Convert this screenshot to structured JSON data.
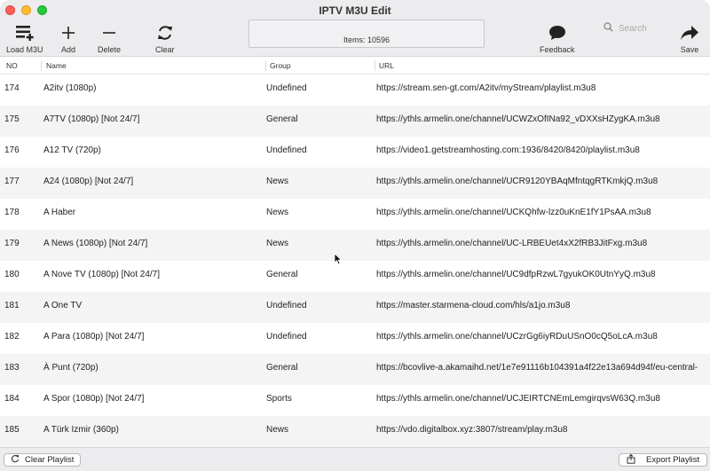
{
  "window": {
    "title": "IPTV M3U Edit"
  },
  "toolbar": {
    "load_label": "Load M3U",
    "add_label": "Add",
    "delete_label": "Delete",
    "clear_label": "Clear",
    "items_text": "Items: 10596",
    "feedback_label": "Feedback",
    "search_placeholder": "Search",
    "save_label": "Save"
  },
  "table": {
    "headers": {
      "no": "NO",
      "name": "Name",
      "group": "Group",
      "url": "URL"
    },
    "rows": [
      {
        "no": "174",
        "name": "A2itv (1080p)",
        "group": "Undefined",
        "url": "https://stream.sen-gt.com/A2itv/myStream/playlist.m3u8"
      },
      {
        "no": "175",
        "name": "A7TV (1080p) [Not 24/7]",
        "group": "General",
        "url": "https://ythls.armelin.one/channel/UCWZxOfINa92_vDXXsHZygKA.m3u8"
      },
      {
        "no": "176",
        "name": "A12 TV (720p)",
        "group": "Undefined",
        "url": "https://video1.getstreamhosting.com:1936/8420/8420/playlist.m3u8"
      },
      {
        "no": "177",
        "name": "A24 (1080p) [Not 24/7]",
        "group": "News",
        "url": "https://ythls.armelin.one/channel/UCR9120YBAqMfntqgRTKmkjQ.m3u8"
      },
      {
        "no": "178",
        "name": "A Haber",
        "group": "News",
        "url": "https://ythls.armelin.one/channel/UCKQhfw-lzz0uKnE1fY1PsAA.m3u8"
      },
      {
        "no": "179",
        "name": "A News (1080p) [Not 24/7]",
        "group": "News",
        "url": "https://ythls.armelin.one/channel/UC-LRBEUet4xX2fRB3JitFxg.m3u8"
      },
      {
        "no": "180",
        "name": "A Nove TV (1080p) [Not 24/7]",
        "group": "General",
        "url": "https://ythls.armelin.one/channel/UC9dfpRzwL7gyukOK0UtnYyQ.m3u8"
      },
      {
        "no": "181",
        "name": "A One TV",
        "group": "Undefined",
        "url": "https://master.starmena-cloud.com/hls/a1jo.m3u8"
      },
      {
        "no": "182",
        "name": "A Para (1080p) [Not 24/7]",
        "group": "Undefined",
        "url": "https://ythls.armelin.one/channel/UCzrGg6iyRDuUSnO0cQ5oLcA.m3u8"
      },
      {
        "no": "183",
        "name": "À Punt (720p)",
        "group": "General",
        "url": "https://bcovlive-a.akamaihd.net/1e7e91116b104391a4f22e13a694d94f/eu-central-"
      },
      {
        "no": "184",
        "name": "A Spor (1080p) [Not 24/7]",
        "group": "Sports",
        "url": "https://ythls.armelin.one/channel/UCJEIRTCNEmLemgirqvsW63Q.m3u8"
      },
      {
        "no": "185",
        "name": "A Türk Izmir (360p)",
        "group": "News",
        "url": "https://vdo.digitalbox.xyz:3807/stream/play.m3u8"
      }
    ]
  },
  "footer": {
    "clear_playlist_label": "Clear Playlist",
    "export_playlist_label": "Export Playlist"
  },
  "colors": {
    "toolbar_bg": "#ecebed",
    "row_alt_bg": "#f4f4f4",
    "close": "#fe5f57",
    "minimize": "#febc2e",
    "zoom": "#28c840"
  },
  "icons": {
    "load": "list-add-icon",
    "add": "plus-icon",
    "delete": "minus-icon",
    "clear": "refresh-icon",
    "feedback": "speech-bubble-icon",
    "search": "magnifier-icon",
    "save": "share-arrow-icon"
  }
}
